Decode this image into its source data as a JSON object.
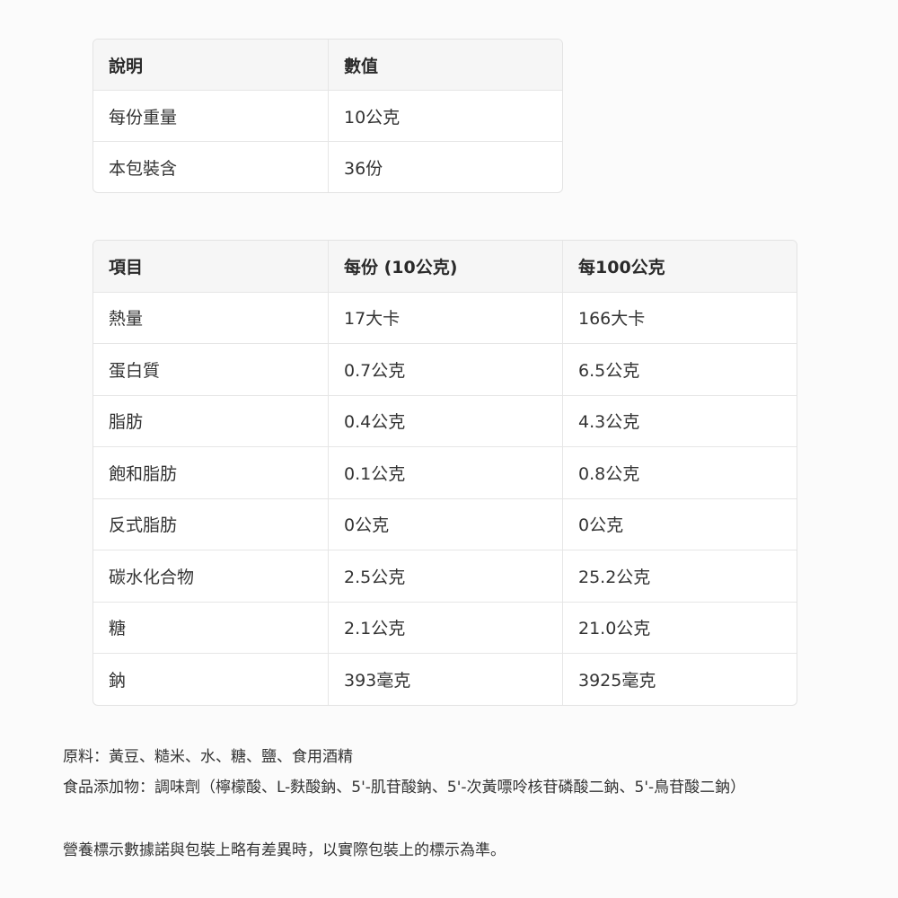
{
  "serving_table": {
    "headers": [
      "說明",
      "數值"
    ],
    "rows": [
      [
        "每份重量",
        "10公克"
      ],
      [
        "本包裝含",
        "36份"
      ]
    ]
  },
  "nutrition_table": {
    "headers": [
      "項目",
      "每份 (10公克)",
      "每100公克"
    ],
    "rows": [
      [
        "熱量",
        "17大卡",
        "166大卡"
      ],
      [
        "蛋白質",
        "0.7公克",
        "6.5公克"
      ],
      [
        "脂肪",
        "0.4公克",
        "4.3公克"
      ],
      [
        "飽和脂肪",
        "0.1公克",
        "0.8公克"
      ],
      [
        "反式脂肪",
        "0公克",
        "0公克"
      ],
      [
        "碳水化合物",
        "2.5公克",
        "25.2公克"
      ],
      [
        "糖",
        "2.1公克",
        "21.0公克"
      ],
      [
        "鈉",
        "393毫克",
        "3925毫克"
      ]
    ]
  },
  "notes": {
    "ingredients": "原料：黃豆、糙米、水、糖、鹽、食用酒精",
    "additives": "食品添加物：調味劑（檸檬酸、L-麩酸鈉、5'-肌苷酸鈉、5'-次黃嘌呤核苷磷酸二鈉、5'-鳥苷酸二鈉）",
    "disclaimer": "營養標示數據諾與包裝上略有差異時，以實際包裝上的標示為準。"
  }
}
